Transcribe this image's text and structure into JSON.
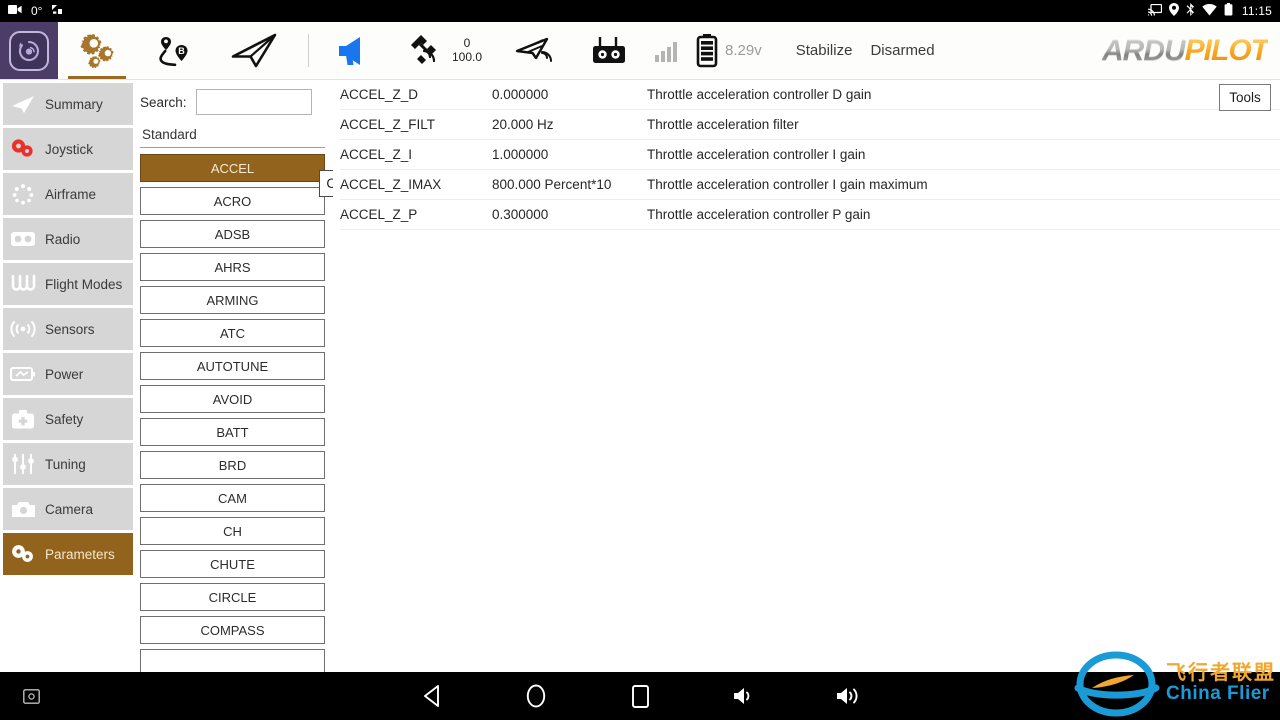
{
  "status_bar": {
    "left_icons": [
      "video-camera-icon",
      "rotation-lock-icon"
    ],
    "rotation_value": "0°",
    "right_icons": [
      "cast-icon",
      "location-icon",
      "bluetooth-icon",
      "wifi-icon",
      "battery-icon"
    ],
    "time": "11:15"
  },
  "app_bar": {
    "logo_name": "qgroundcontrol-logo",
    "items": [
      {
        "name": "settings-gears-icon",
        "active": true
      },
      {
        "name": "plan-route-icon",
        "active": false
      },
      {
        "name": "fly-view-icon",
        "active": false
      }
    ],
    "telemetry": {
      "megaphone_icon": "megaphone-icon",
      "gps_icon": "satellite-icon",
      "gps_count": "0",
      "gps_hdop": "100.0",
      "vehicle_icon": "vehicle-icon",
      "rc_icon": "rc-transmitter-icon",
      "signal_icon": "signal-bars-icon",
      "battery_icon": "battery-icon",
      "voltage": "8.29v",
      "flight_mode": "Stabilize",
      "arm_state": "Disarmed"
    },
    "brand": {
      "part1": "ARDU",
      "part2": "PILOT"
    }
  },
  "sidebar": {
    "items": [
      {
        "label": "Summary",
        "icon": "paper-plane-icon",
        "selected": false
      },
      {
        "label": "Joystick",
        "icon": "joystick-gears-icon",
        "selected": false
      },
      {
        "label": "Airframe",
        "icon": "airframe-icon",
        "selected": false
      },
      {
        "label": "Radio",
        "icon": "radio-icon",
        "selected": false
      },
      {
        "label": "Flight Modes",
        "icon": "flight-modes-icon",
        "selected": false
      },
      {
        "label": "Sensors",
        "icon": "sensors-icon",
        "selected": false
      },
      {
        "label": "Power",
        "icon": "power-icon",
        "selected": false
      },
      {
        "label": "Safety",
        "icon": "safety-icon",
        "selected": false
      },
      {
        "label": "Tuning",
        "icon": "tuning-sliders-icon",
        "selected": false
      },
      {
        "label": "Camera",
        "icon": "camera-icon",
        "selected": false
      },
      {
        "label": "Parameters",
        "icon": "parameters-gears-icon",
        "selected": true
      }
    ]
  },
  "search": {
    "label": "Search:",
    "value": "",
    "placeholder": "",
    "clear_label": "Clear"
  },
  "groups": {
    "section_label": "Standard",
    "items": [
      {
        "label": "ACCEL",
        "selected": true
      },
      {
        "label": "ACRO",
        "selected": false
      },
      {
        "label": "ADSB",
        "selected": false
      },
      {
        "label": "AHRS",
        "selected": false
      },
      {
        "label": "ARMING",
        "selected": false
      },
      {
        "label": "ATC",
        "selected": false
      },
      {
        "label": "AUTOTUNE",
        "selected": false
      },
      {
        "label": "AVOID",
        "selected": false
      },
      {
        "label": "BATT",
        "selected": false
      },
      {
        "label": "BRD",
        "selected": false
      },
      {
        "label": "CAM",
        "selected": false
      },
      {
        "label": "CH",
        "selected": false
      },
      {
        "label": "CHUTE",
        "selected": false
      },
      {
        "label": "CIRCLE",
        "selected": false
      },
      {
        "label": "COMPASS",
        "selected": false
      },
      {
        "label": "",
        "selected": false
      }
    ]
  },
  "parameters": {
    "tools_label": "Tools",
    "rows": [
      {
        "name": "ACCEL_Z_D",
        "value": "0.000000",
        "description": "Throttle acceleration controller D gain"
      },
      {
        "name": "ACCEL_Z_FILT",
        "value": "20.000 Hz",
        "description": "Throttle acceleration filter"
      },
      {
        "name": "ACCEL_Z_I",
        "value": "1.000000",
        "description": "Throttle acceleration controller I gain"
      },
      {
        "name": "ACCEL_Z_IMAX",
        "value": "800.000 Percent*10",
        "description": "Throttle acceleration controller I gain maximum"
      },
      {
        "name": "ACCEL_Z_P",
        "value": "0.300000",
        "description": "Throttle acceleration controller P gain"
      }
    ]
  },
  "watermark": {
    "cn": "飞行者联盟",
    "en": "China Flier"
  },
  "nav_bar": {
    "buttons": [
      "screenshot-icon",
      "back-icon",
      "home-icon",
      "recents-icon",
      "volume-down-icon",
      "volume-up-icon"
    ]
  },
  "colors": {
    "accent_brown": "#92631d",
    "sidebar_gray": "#d6d6d6",
    "logo_purple": "#4b3d67",
    "brand_orange": "#f9a825"
  }
}
